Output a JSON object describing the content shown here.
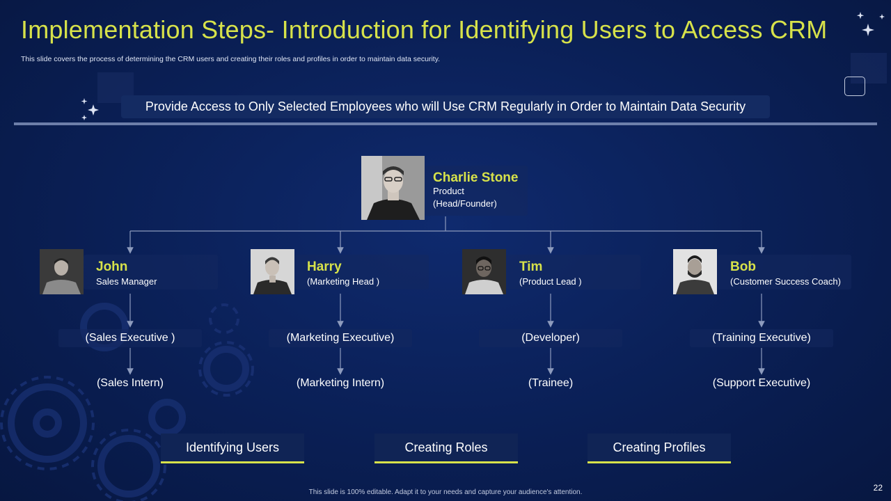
{
  "slide": {
    "title": "Implementation  Steps- Introduction for Identifying Users to Access CRM",
    "subtitle": "This slide covers the process of determining the CRM users and creating their roles and profiles in order to maintain data security.",
    "banner": "Provide Access to Only Selected Employees who will Use CRM Regularly in Order to Maintain Data Security",
    "footer": "This slide is 100% editable. Adapt it to your needs and capture your audience's attention.",
    "page_number": "22"
  },
  "colors": {
    "background": "#0a1f55",
    "accent": "#d7e24a",
    "text": "#ffffff",
    "card": "#142b62"
  },
  "org": {
    "head": {
      "name": "Charlie Stone",
      "role_line1": "Product",
      "role_line2": "(Head/Founder)"
    },
    "managers": [
      {
        "name": "John",
        "role": "Sales Manager",
        "reports": [
          "(Sales Executive )",
          "(Sales Intern)"
        ]
      },
      {
        "name": "Harry",
        "role": "(Marketing Head )",
        "reports": [
          "(Marketing Executive)",
          "(Marketing Intern)"
        ]
      },
      {
        "name": "Tim",
        "role": "(Product Lead )",
        "reports": [
          "(Developer)",
          "(Trainee)"
        ]
      },
      {
        "name": "Bob",
        "role": "(Customer Success Coach)",
        "reports": [
          "(Training Executive)",
          "(Support Executive)"
        ]
      }
    ]
  },
  "steps": [
    "Identifying Users",
    "Creating Roles",
    "Creating Profiles"
  ]
}
